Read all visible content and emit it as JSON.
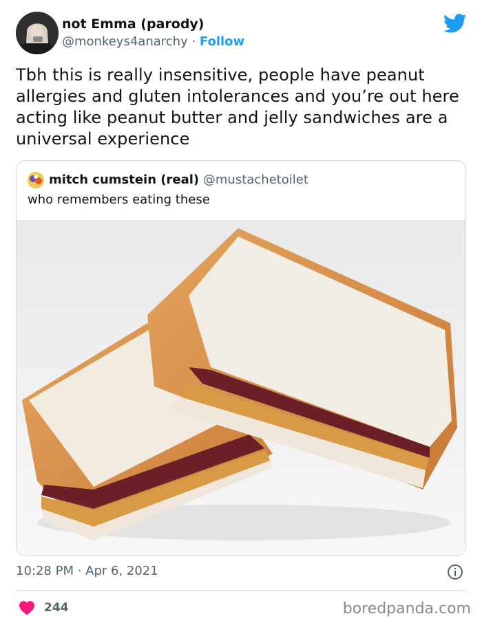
{
  "author": {
    "display_name": "not Emma (parody)",
    "handle": "@monkeys4anarchy",
    "separator": " · ",
    "follow_label": "Follow"
  },
  "tweet": {
    "text": "Tbh this is really insensitive, people have peanut allergies and gluten intolerances and you’re out here acting like peanut butter and jelly sandwiches are a universal experience"
  },
  "quoted_tweet": {
    "display_name": "mitch cumstein (real)",
    "handle": "@mustachetoilet",
    "text": "who remembers eating these"
  },
  "meta": {
    "timestamp": "10:28 PM · Apr 6, 2021",
    "like_count": "244",
    "watermark": "boredpanda.com"
  },
  "colors": {
    "link": "#1d9bf0",
    "heart": "#f91880",
    "secondary_text": "#536471"
  },
  "icons": [
    "twitter-bird-icon",
    "info-icon",
    "heart-icon"
  ]
}
